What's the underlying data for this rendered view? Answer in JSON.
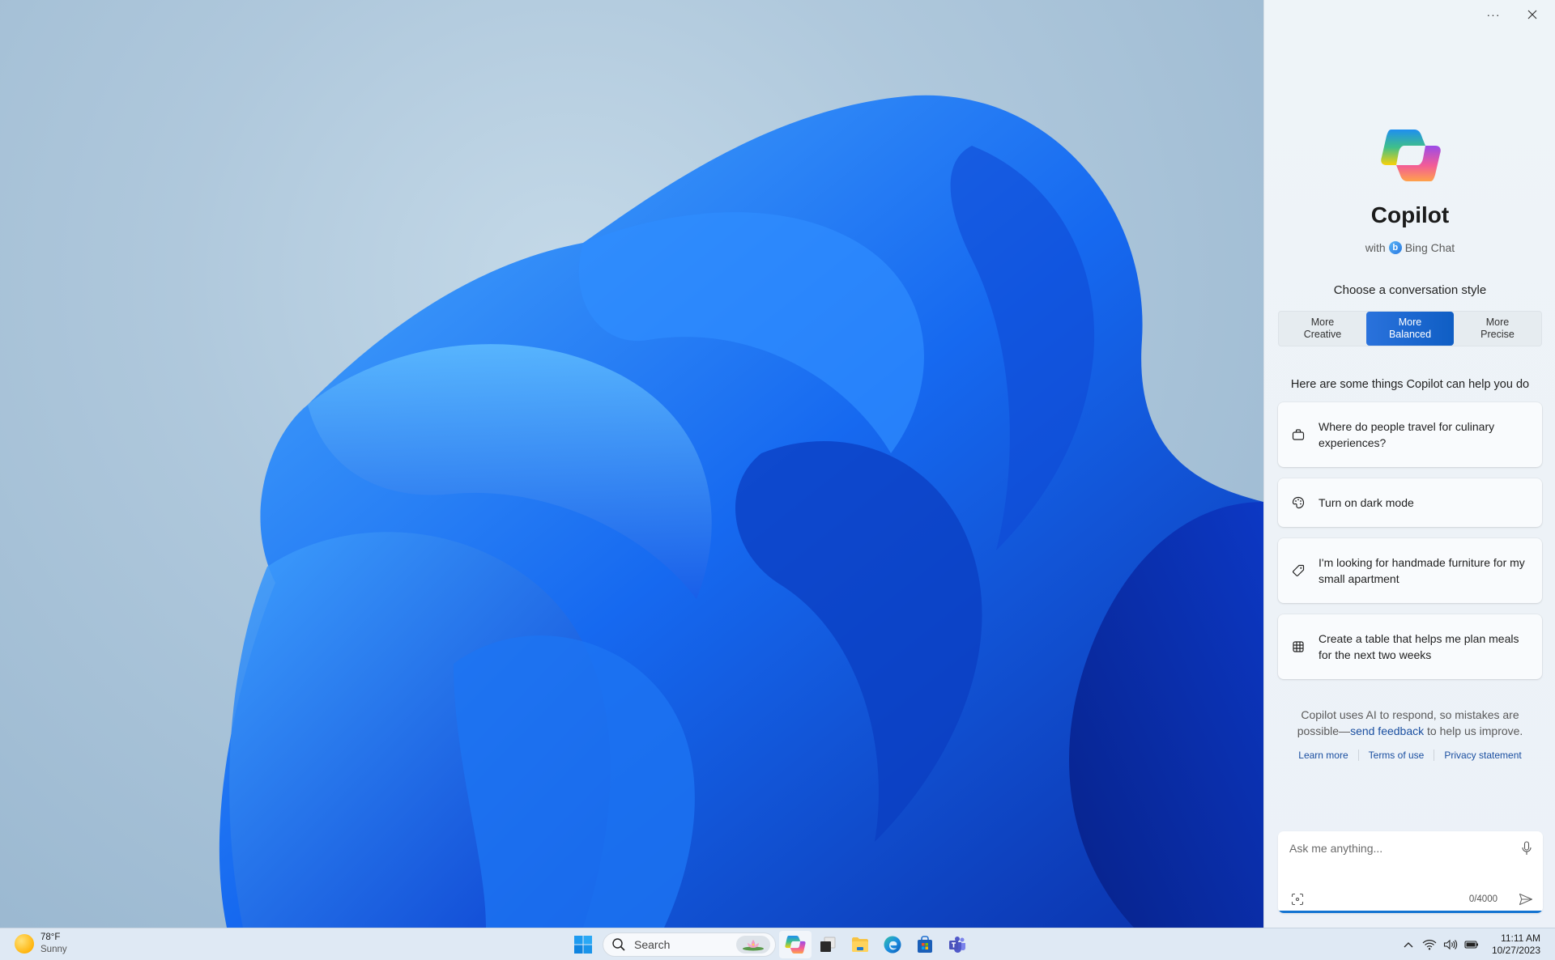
{
  "panel": {
    "title": "Copilot",
    "subtitle_prefix": "with",
    "subtitle_brand": "Bing Chat",
    "more_label": "···",
    "style_heading": "Choose a conversation style",
    "styles": [
      {
        "line1": "More",
        "line2": "Creative",
        "active": false
      },
      {
        "line1": "More",
        "line2": "Balanced",
        "active": true
      },
      {
        "line1": "More",
        "line2": "Precise",
        "active": false
      }
    ],
    "help_heading": "Here are some things Copilot can help you do",
    "suggestions": [
      {
        "icon": "briefcase-icon",
        "text": "Where do people travel for culinary experiences?"
      },
      {
        "icon": "palette-icon",
        "text": "Turn on dark mode"
      },
      {
        "icon": "tag-icon",
        "text": "I'm looking for handmade furniture for my small apartment"
      },
      {
        "icon": "table-icon",
        "text": "Create a table that helps me plan meals for the next two weeks"
      }
    ],
    "disclaimer_pre": "Copilot uses AI to respond, so mistakes are possible—",
    "disclaimer_link": "send feedback",
    "disclaimer_post": " to help us improve.",
    "links": [
      "Learn more",
      "Terms of use",
      "Privacy statement"
    ],
    "composer": {
      "placeholder": "Ask me anything...",
      "value": "",
      "char_count": "0/4000"
    },
    "accent_color": "#1373d1"
  },
  "taskbar": {
    "weather": {
      "temp": "78°F",
      "condition": "Sunny"
    },
    "search_label": "Search",
    "apps": [
      "Copilot",
      "Task View",
      "File Explorer",
      "Microsoft Edge",
      "Microsoft Store",
      "Microsoft Teams"
    ],
    "clock": {
      "time": "11:11 AM",
      "date": "10/27/2023"
    }
  }
}
